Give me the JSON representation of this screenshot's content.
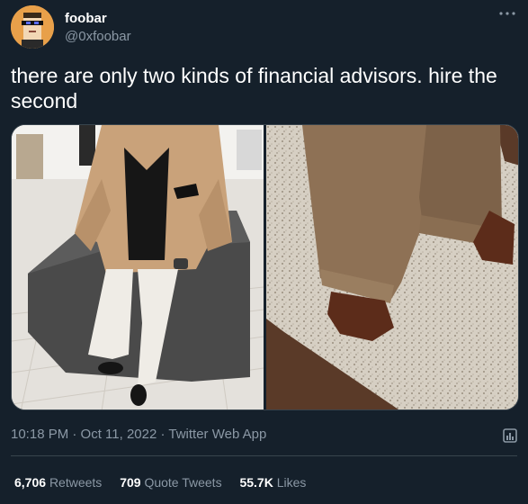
{
  "author": {
    "display_name": "foobar",
    "handle": "@0xfoobar",
    "avatar_icon": "pixel-punk-avatar-icon"
  },
  "tweet": {
    "text": "there are only two kinds of financial advisors. hire the second",
    "timestamp": "10:18 PM · Oct 11, 2022 · Twitter Web App"
  },
  "media": [
    {
      "name": "man-in-tan-blazer-photo"
    },
    {
      "name": "baggy-brown-trousers-photo"
    }
  ],
  "stats": {
    "retweets_count": "6,706",
    "retweets_label": "Retweets",
    "quotes_count": "709",
    "quotes_label": "Quote Tweets",
    "likes_count": "55.7K",
    "likes_label": "Likes"
  },
  "colors": {
    "background": "#15202b",
    "secondary_text": "#8b98a5",
    "divider": "#38444d"
  }
}
